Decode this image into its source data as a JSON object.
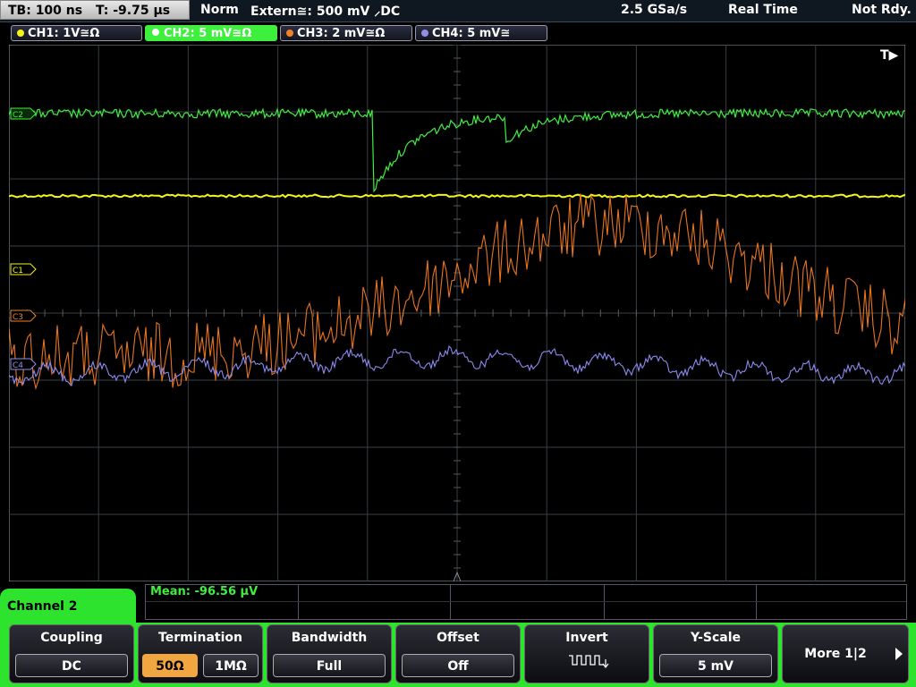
{
  "status": {
    "timebase": "TB: 100 ns",
    "trigger_time": "T: -9.75 µs",
    "acq_mode": "Norm",
    "trigger_source": "Extern≅: 500 mV ⸝DC",
    "sample_rate": "2.5 GSa/s",
    "time_mode": "Real Time",
    "state": "Not Rdy."
  },
  "channels": [
    {
      "label": "CH1: 1V≅Ω",
      "color": "#f5f518"
    },
    {
      "label": "CH2: 5 mV≅Ω",
      "color": "#3eef3e"
    },
    {
      "label": "CH3: 2 mV≅Ω",
      "color": "#f0812a"
    },
    {
      "label": "CH4: 5 mV≅",
      "color": "#8f8fe8"
    }
  ],
  "trace_markers": {
    "c1": "C1",
    "c3": "C3",
    "c4": "C4",
    "c2": "C2"
  },
  "trigger_marker": "T▶",
  "measurement": {
    "mean": "Mean: -96.56 µV"
  },
  "menu": {
    "title": "Channel 2",
    "coupling": {
      "label": "Coupling",
      "value": "DC"
    },
    "termination": {
      "label": "Termination",
      "opt1": "50Ω",
      "opt2": "1MΩ"
    },
    "bandwidth": {
      "label": "Bandwidth",
      "value": "Full"
    },
    "offset": {
      "label": "Offset",
      "value": "Off"
    },
    "invert": {
      "label": "Invert"
    },
    "yscale": {
      "label": "Y-Scale",
      "value": "5 mV"
    },
    "more": {
      "label": "More 1|2"
    }
  }
}
